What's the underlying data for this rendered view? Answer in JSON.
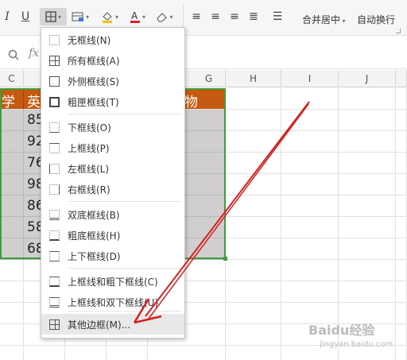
{
  "toolbar": {
    "italic_icon": "italic-icon",
    "underline_icon": "underline-icon",
    "merge_label": "合并居中",
    "wrap_label": "自动换行"
  },
  "columns": [
    "C",
    "",
    "",
    "",
    "G",
    "H",
    "I",
    "J"
  ],
  "header_cells": [
    "学",
    "英",
    "",
    "",
    "物"
  ],
  "data_values": [
    "85",
    "92",
    "76",
    "98",
    "86",
    "58",
    "68"
  ],
  "border_menu": {
    "items": [
      {
        "label": "无框线(N)",
        "icon": "no-border-icon"
      },
      {
        "label": "所有框线(A)",
        "icon": "all-borders-icon"
      },
      {
        "label": "外侧框线(S)",
        "icon": "outside-borders-icon"
      },
      {
        "label": "粗匣框线(T)",
        "icon": "thick-box-border-icon"
      },
      {
        "label": "下框线(O)",
        "icon": "bottom-border-icon"
      },
      {
        "label": "上框线(P)",
        "icon": "top-border-icon"
      },
      {
        "label": "左框线(L)",
        "icon": "left-border-icon"
      },
      {
        "label": "右框线(R)",
        "icon": "right-border-icon"
      },
      {
        "label": "双底框线(B)",
        "icon": "double-bottom-border-icon"
      },
      {
        "label": "粗底框线(H)",
        "icon": "thick-bottom-border-icon"
      },
      {
        "label": "上下框线(D)",
        "icon": "top-bottom-border-icon"
      },
      {
        "label": "上框线和粗下框线(C)",
        "icon": "top-thick-bottom-border-icon"
      },
      {
        "label": "上框线和双下框线(U)",
        "icon": "top-double-bottom-border-icon"
      },
      {
        "label": "其他边框(M)...",
        "icon": "more-borders-icon"
      }
    ]
  },
  "watermark": {
    "brand": "Baidu经验",
    "url": "jingyan.baidu.com"
  },
  "colors": {
    "accent_green": "#3f9d3f",
    "header_orange": "#c55a11",
    "data_gray": "#d0cece",
    "arrow_red": "#d42020"
  }
}
